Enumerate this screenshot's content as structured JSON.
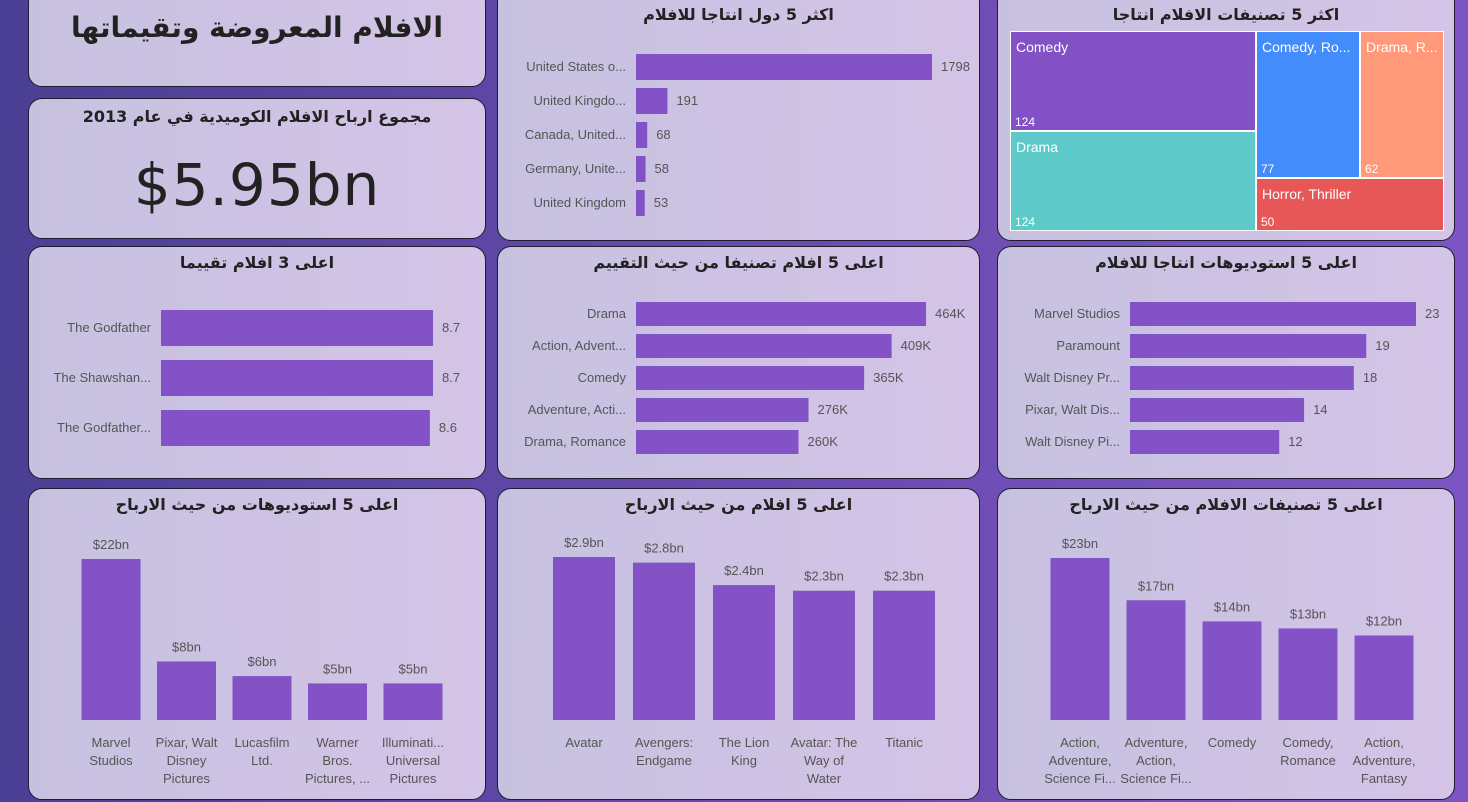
{
  "header": {
    "title": "الافلام المعروضة وتقيماتها"
  },
  "kpi": {
    "title": "مجموع ارباح الافلام الكوميدية في عام 2013",
    "value": "$5.95bn"
  },
  "colors": {
    "bar": "#8352c6",
    "treemap": [
      "#8350c6",
      "#428cfc",
      "#ff9979",
      "#5ec9c9",
      "#e85757"
    ]
  },
  "chart_data": [
    {
      "id": "countries",
      "type": "bar",
      "title": "اكثر 5 دول انتاجا للافلام",
      "categories": [
        "United States o...",
        "United Kingdo...",
        "Canada, United...",
        "Germany, Unite...",
        "United Kingdom"
      ],
      "values": [
        1798,
        191,
        68,
        58,
        53
      ],
      "labels": [
        "1798",
        "191",
        "68",
        "58",
        "53"
      ]
    },
    {
      "id": "genres-count",
      "type": "treemap",
      "title": "اكثر 5 تصنيفات الافلام انتاجا",
      "items": [
        {
          "name": "Comedy",
          "value": 124,
          "label": "124"
        },
        {
          "name": "Comedy, Ro...",
          "value": 77,
          "label": "77"
        },
        {
          "name": "Drama, R...",
          "value": 62,
          "label": "62"
        },
        {
          "name": "Drama",
          "value": 124,
          "label": "124"
        },
        {
          "name": "Horror, Thriller",
          "value": 50,
          "label": "50"
        }
      ]
    },
    {
      "id": "top-rated",
      "type": "bar",
      "title": "اعلى 3 افلام تقييما",
      "categories": [
        "The Godfather",
        "The Shawshan...",
        "The Godfather..."
      ],
      "values": [
        8.7,
        8.7,
        8.6
      ],
      "labels": [
        "8.7",
        "8.7",
        "8.6"
      ]
    },
    {
      "id": "genres-rating",
      "type": "bar",
      "title": "اعلى 5 افلام تصنيفا من حيث التقييم",
      "categories": [
        "Drama",
        "Action, Advent...",
        "Comedy",
        "Adventure, Acti...",
        "Drama, Romance"
      ],
      "values": [
        464,
        409,
        365,
        276,
        260
      ],
      "labels": [
        "464K",
        "409K",
        "365K",
        "276K",
        "260K"
      ]
    },
    {
      "id": "studios-count",
      "type": "bar",
      "title": "اعلى 5 استوديوهات انتاجا للافلام",
      "categories": [
        "Marvel Studios",
        "Paramount",
        "Walt Disney Pr...",
        "Pixar, Walt Dis...",
        "Walt Disney Pi..."
      ],
      "values": [
        23,
        19,
        18,
        14,
        12
      ],
      "labels": [
        "23",
        "19",
        "18",
        "14",
        "12"
      ]
    },
    {
      "id": "studios-profit",
      "type": "column",
      "title": "اعلى 5 استوديوهات من حيث الارباح",
      "categories": [
        [
          "Marvel",
          "Studios"
        ],
        [
          "Pixar, Walt",
          "Disney",
          "Pictures"
        ],
        [
          "Lucasfilm",
          "Ltd."
        ],
        [
          "Warner",
          "Bros.",
          "Pictures, ..."
        ],
        [
          "Illuminati...",
          "Universal",
          "Pictures"
        ]
      ],
      "values": [
        22,
        8,
        6,
        5,
        5
      ],
      "labels": [
        "$22bn",
        "$8bn",
        "$6bn",
        "$5bn",
        "$5bn"
      ]
    },
    {
      "id": "movies-profit",
      "type": "column",
      "title": "اعلى 5 افلام من حيث الارباح",
      "categories": [
        [
          "Avatar"
        ],
        [
          "Avengers:",
          "Endgame"
        ],
        [
          "The Lion",
          "King"
        ],
        [
          "Avatar: The",
          "Way of",
          "Water"
        ],
        [
          "Titanic"
        ]
      ],
      "values": [
        2.9,
        2.8,
        2.4,
        2.3,
        2.3
      ],
      "labels": [
        "$2.9bn",
        "$2.8bn",
        "$2.4bn",
        "$2.3bn",
        "$2.3bn"
      ]
    },
    {
      "id": "genres-profit",
      "type": "column",
      "title": "اعلى 5 تصنيفات الافلام من حيث الارباح",
      "categories": [
        [
          "Action,",
          "Adventure,",
          "Science Fi..."
        ],
        [
          "Adventure,",
          "Action,",
          "Science Fi..."
        ],
        [
          "Comedy"
        ],
        [
          "Comedy,",
          "Romance"
        ],
        [
          "Action,",
          "Adventure,",
          "Fantasy"
        ]
      ],
      "values": [
        23,
        17,
        14,
        13,
        12
      ],
      "labels": [
        "$23bn",
        "$17bn",
        "$14bn",
        "$13bn",
        "$12bn"
      ]
    }
  ]
}
